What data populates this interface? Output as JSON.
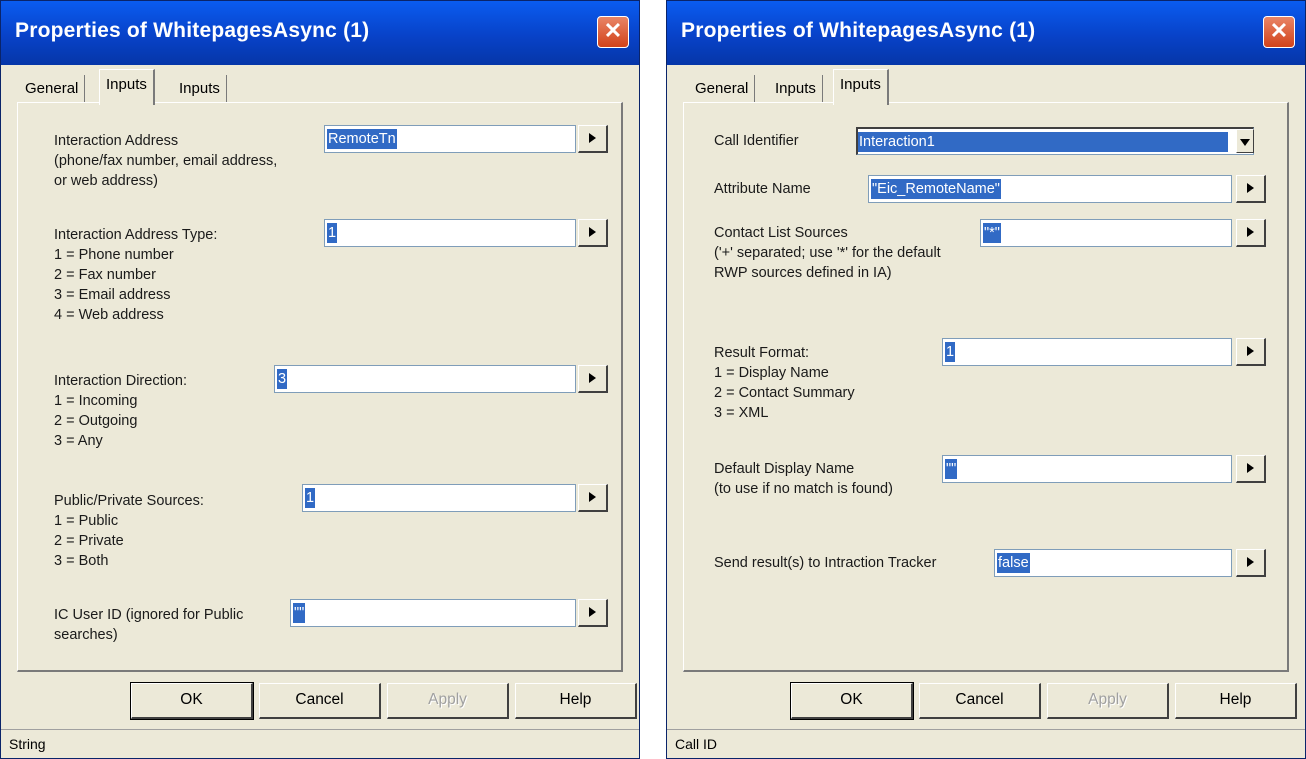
{
  "left": {
    "title": "Properties of WhitepagesAsync (1)",
    "close_glyph": "✕",
    "tabs": [
      "General",
      "Inputs",
      "Inputs"
    ],
    "fields": [
      {
        "label": "Interaction Address\n(phone/fax number, email address,\nor web address)",
        "value": "RemoteTn"
      },
      {
        "label": "Interaction Address Type:\n1 = Phone number\n2 = Fax number\n3 = Email address\n4 = Web address",
        "value": "1"
      },
      {
        "label": "Interaction Direction:\n1 = Incoming\n2 = Outgoing\n3 = Any",
        "value": "3"
      },
      {
        "label": "Public/Private Sources:\n1 = Public\n2 = Private\n3 = Both",
        "value": "1"
      },
      {
        "label": "IC User ID (ignored for Public\nsearches)",
        "value": "\"\""
      }
    ],
    "buttons": {
      "ok": "OK",
      "cancel": "Cancel",
      "apply": "Apply",
      "help": "Help"
    },
    "status": "String"
  },
  "right": {
    "title": "Properties of WhitepagesAsync (1)",
    "close_glyph": "✕",
    "tabs": [
      "General",
      "Inputs",
      "Inputs"
    ],
    "fields": [
      {
        "label": "Call Identifier",
        "value": "Interaction1"
      },
      {
        "label": "Attribute Name",
        "value": "\"Eic_RemoteName\""
      },
      {
        "label": "Contact List Sources\n('+' separated; use '*' for the default\nRWP sources defined in IA)",
        "value": "\"*\""
      },
      {
        "label": "Result Format:\n1 = Display Name\n2 = Contact Summary\n3 = XML",
        "value": "1"
      },
      {
        "label": "Default Display Name\n(to use if no match is found)",
        "value": "\"\""
      },
      {
        "label": "Send result(s) to Intraction Tracker",
        "value": "false"
      }
    ],
    "buttons": {
      "ok": "OK",
      "cancel": "Cancel",
      "apply": "Apply",
      "help": "Help"
    },
    "status": "Call ID"
  }
}
